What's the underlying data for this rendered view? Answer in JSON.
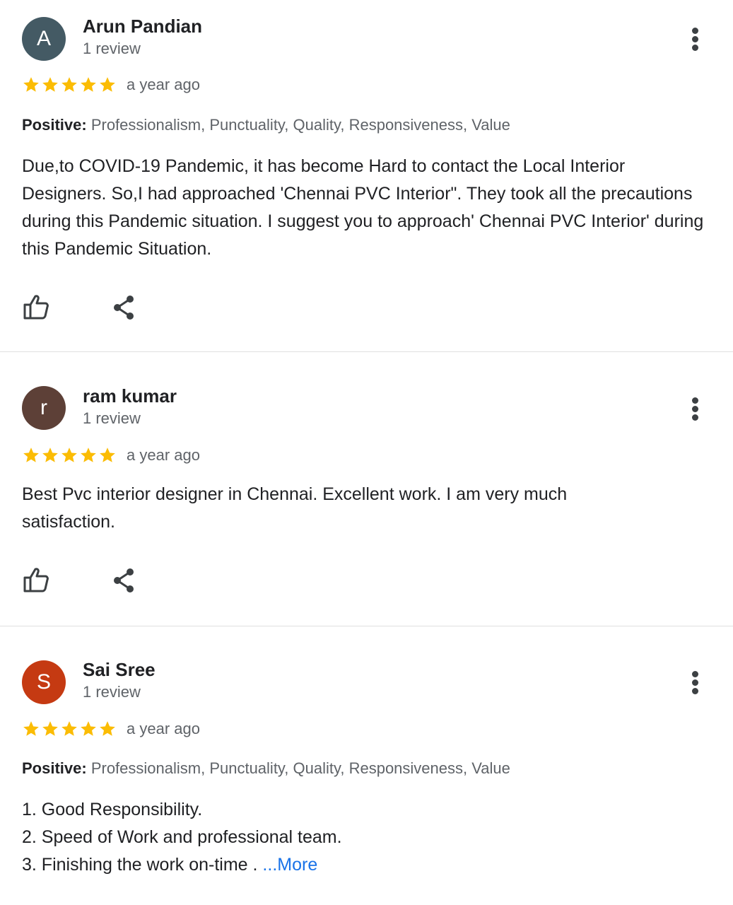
{
  "colors": {
    "star": "#fbbc04",
    "link": "#1a73e8"
  },
  "reviews": [
    {
      "avatar_letter": "A",
      "avatar_color": "#445a64",
      "name": "Arun Pandian",
      "count": "1 review",
      "rating": 5,
      "time": "a year ago",
      "positive_label": "Positive:",
      "positive_text": " Professionalism, Punctuality, Quality, Responsiveness, Value",
      "text": "Due,to COVID-19 Pandemic, it has become Hard to contact the Local Interior Designers. So,I had approached 'Chennai PVC Interior\". They took all the precautions during this Pandemic situation. I suggest you to approach' Chennai PVC Interior' during this Pandemic Situation."
    },
    {
      "avatar_letter": "r",
      "avatar_color": "#5d4037",
      "name": "ram kumar",
      "count": "1 review",
      "rating": 5,
      "time": "a year ago",
      "text": "Best Pvc interior designer in Chennai. Excellent work. I am very much satisfaction."
    },
    {
      "avatar_letter": "S",
      "avatar_color": "#c53a12",
      "name": "Sai Sree",
      "count": "1 review",
      "rating": 5,
      "time": "a year ago",
      "positive_label": "Positive:",
      "positive_text": " Professionalism, Punctuality, Quality, Responsiveness, Value",
      "lines": [
        "1. Good Responsibility.",
        "2. Speed of Work and professional team.",
        "3. Finishing the work on-time . "
      ],
      "more": "...More"
    }
  ]
}
